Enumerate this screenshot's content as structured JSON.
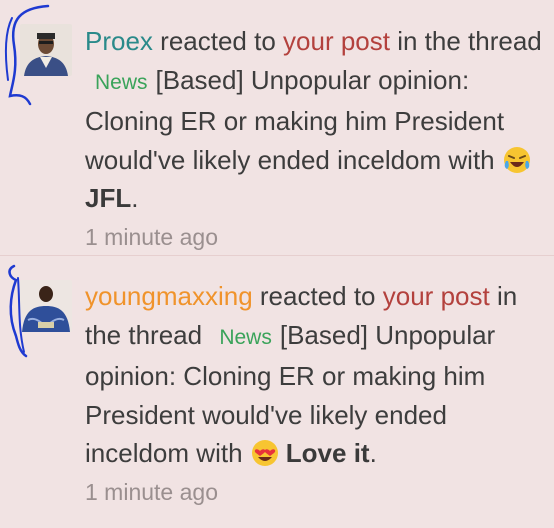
{
  "alerts": [
    {
      "user": "Proex",
      "reacted_text": "reacted to",
      "post_link": "your post",
      "in_text": "in the thread",
      "prefix_tag": "News",
      "thread_title": "[Based] Unpopular opinion: Cloning ER or making him President would've likely ended inceldom",
      "with_text": "with",
      "reaction_icon": "laugh-cry-emoji-icon",
      "reaction": "JFL",
      "period": ".",
      "time": "1 minute ago"
    },
    {
      "user": "youngmaxxing",
      "reacted_text": "reacted to",
      "post_link": "your post",
      "in_text": "in the thread",
      "prefix_tag": "News",
      "thread_title": "[Based] Unpopular opinion: Cloning ER or making him President would've likely ended inceldom",
      "with_text": "with",
      "reaction_icon": "heart-eyes-emoji-icon",
      "reaction": "Love it",
      "period": ".",
      "time": "1 minute ago"
    }
  ],
  "colors": {
    "background": "#f1e3e3",
    "user_1": "#2a8a8a",
    "user_2": "#f0932b",
    "link": "#b3413d",
    "tag": "#3aa35a",
    "time": "#9a8f8f",
    "scribble": "#1f3ad1"
  }
}
